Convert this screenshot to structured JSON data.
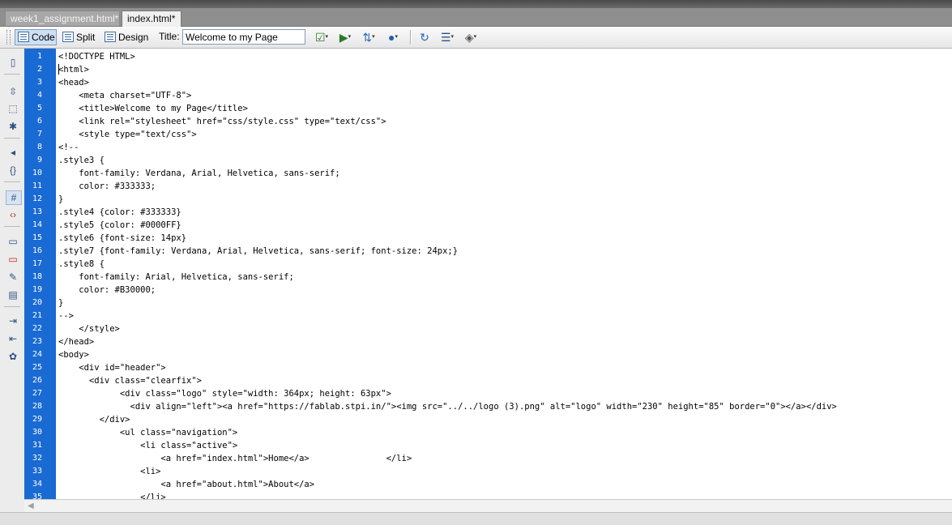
{
  "tabs": [
    {
      "label": "week1_assignment.html*"
    },
    {
      "label": "index.html*"
    }
  ],
  "toolbar": {
    "view_buttons": [
      "Code",
      "Split",
      "Design"
    ],
    "title_label": "Title:",
    "title_value": "Welcome to my Page",
    "icons": [
      "validate-markup-icon",
      "preview-in-browser-icon",
      "file-management-icon",
      "globe-icon",
      "refresh-icon",
      "view-options-icon",
      "visual-aids-icon"
    ]
  },
  "left_toolbar": {
    "icons": [
      "open-documents-icon",
      "collapse-full-tag-icon",
      "collapse-selection-icon",
      "expand-all-icon",
      "select-parent-tag-icon",
      "balance-braces-icon",
      "line-numbers-icon",
      "highlight-invalid-code-icon",
      "apply-comment-icon",
      "remove-comment-icon",
      "wrap-tag-icon",
      "recent-snippets-icon",
      "indent-code-icon",
      "outdent-code-icon",
      "format-source-code-icon"
    ]
  },
  "code": {
    "line_numbers": [
      "1",
      "2",
      "3",
      "4",
      "5",
      "6",
      "7",
      "8",
      "9",
      "10",
      "11",
      "12",
      "13",
      "14",
      "15",
      "16",
      "17",
      "18",
      "19",
      "20",
      "21",
      "22",
      "23",
      "24",
      "25",
      "26",
      "27",
      "28",
      "29",
      "30",
      "31",
      "32",
      "33",
      "34",
      "35"
    ],
    "lines": [
      "<!DOCTYPE HTML>",
      "<html>",
      "<head>",
      "    <meta charset=\"UTF-8\">",
      "    <title>Welcome to my Page</title>",
      "    <link rel=\"stylesheet\" href=\"css/style.css\" type=\"text/css\">",
      "    <style type=\"text/css\">",
      "<!--",
      ".style3 {",
      "    font-family: Verdana, Arial, Helvetica, sans-serif;",
      "    color: #333333;",
      "}",
      ".style4 {color: #333333}",
      ".style5 {color: #0000FF}",
      ".style6 {font-size: 14px}",
      ".style7 {font-family: Verdana, Arial, Helvetica, sans-serif; font-size: 24px;}",
      ".style8 {",
      "    font-family: Arial, Helvetica, sans-serif;",
      "    color: #B30000;",
      "}",
      "-->",
      "    </style>",
      "</head>",
      "<body>",
      "    <div id=\"header\">",
      "      <div class=\"clearfix\">",
      "            <div class=\"logo\" style=\"width: 364px; height: 63px\">",
      "              <div align=\"left\"><a href=\"https://fablab.stpi.in/\"><img src=\"../../logo (3).png\" alt=\"logo\" width=\"230\" height=\"85\" border=\"0\"></a></div>",
      "        </div>",
      "            <ul class=\"navigation\">",
      "                <li class=\"active\">",
      "                    <a href=\"index.html\">Home</a>               </li>",
      "                <li>",
      "                    <a href=\"about.html\">About</a>",
      "                </li>"
    ]
  }
}
